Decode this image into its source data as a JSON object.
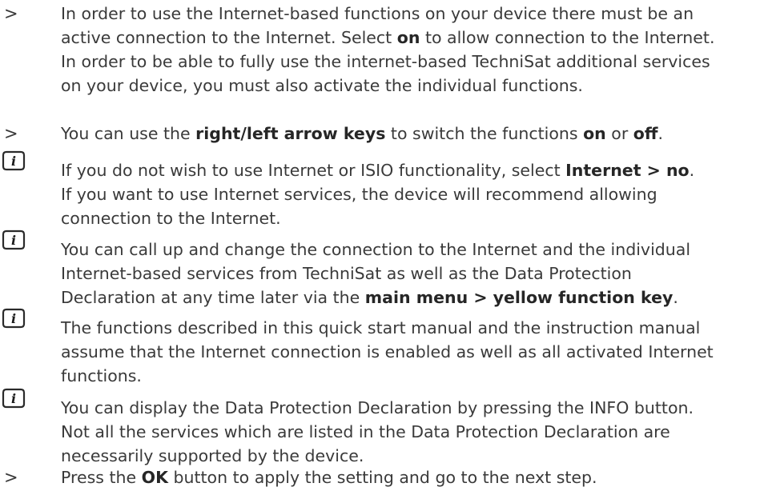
{
  "markers": {
    "arrow": ">"
  },
  "items": [
    {
      "type": "step",
      "parts": [
        {
          "t": "In order to use the Internet-based functions on your device there must be an"
        },
        {
          "t": "\n"
        },
        {
          "t": "active connection to the Internet. Select "
        },
        {
          "t": "on",
          "b": true
        },
        {
          "t": " to allow connection to the Internet."
        },
        {
          "t": "\n"
        },
        {
          "t": "In order to be able to fully use the internet-based TechniSat additional services"
        },
        {
          "t": "\n"
        },
        {
          "t": "on your device, you must also activate the individual functions."
        }
      ]
    },
    {
      "type": "step",
      "parts": [
        {
          "t": "You can use the "
        },
        {
          "t": "right/left arrow keys",
          "b": true
        },
        {
          "t": " to switch the functions "
        },
        {
          "t": "on",
          "b": true
        },
        {
          "t": " or "
        },
        {
          "t": "off",
          "b": true
        },
        {
          "t": "."
        }
      ]
    },
    {
      "type": "info",
      "parts": [
        {
          "t": "If you do not wish to use Internet or ISIO functionality, select "
        },
        {
          "t": "Internet > no",
          "b": true
        },
        {
          "t": "."
        },
        {
          "t": "\n"
        },
        {
          "t": "If you want to use Internet services, the device will recommend allowing"
        },
        {
          "t": "\n"
        },
        {
          "t": "connection to the Internet."
        }
      ]
    },
    {
      "type": "info",
      "parts": [
        {
          "t": "You can call up and change the connection to the Internet and the individual"
        },
        {
          "t": "\n"
        },
        {
          "t": "Internet-based services from TechniSat as well as the Data Protection"
        },
        {
          "t": "\n"
        },
        {
          "t": "Declaration at any time later via the "
        },
        {
          "t": "main menu > yellow function key",
          "b": true
        },
        {
          "t": "."
        }
      ]
    },
    {
      "type": "info",
      "parts": [
        {
          "t": "The functions described in this quick start manual and the instruction manual"
        },
        {
          "t": "\n"
        },
        {
          "t": "assume that the Internet connection is enabled as well as all activated Internet"
        },
        {
          "t": "\n"
        },
        {
          "t": "functions."
        }
      ]
    },
    {
      "type": "info",
      "parts": [
        {
          "t": "You can display the Data Protection Declaration by pressing the INFO button."
        },
        {
          "t": "\n"
        },
        {
          "t": "Not all the services which are listed in the Data Protection Declaration are"
        },
        {
          "t": "\n"
        },
        {
          "t": "necessarily supported by the device."
        }
      ]
    },
    {
      "type": "step",
      "parts": [
        {
          "t": "Press the "
        },
        {
          "t": "OK",
          "b": true
        },
        {
          "t": " button to apply the setting and go to the next step."
        }
      ]
    }
  ]
}
